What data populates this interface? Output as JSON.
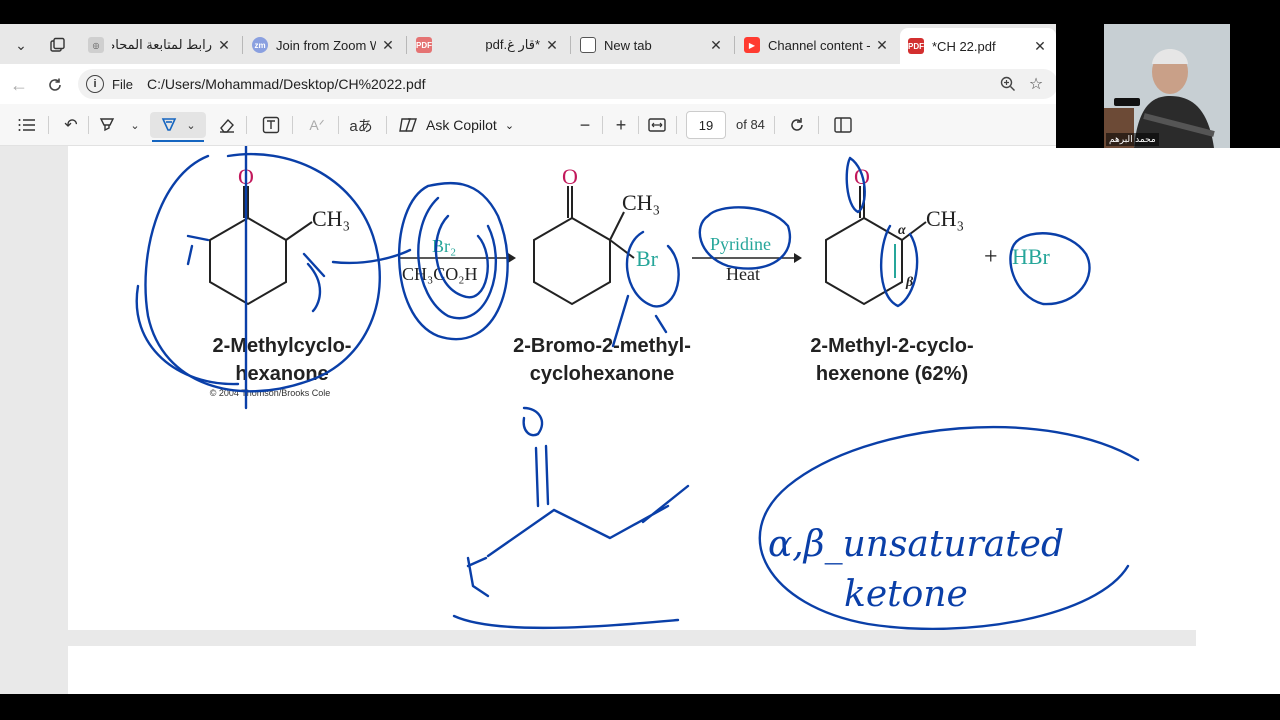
{
  "browser": {
    "tabs": [
      {
        "label": "رابط لمتابعة المحاضرة",
        "icon": "doc-icon",
        "active": false
      },
      {
        "label": "Join from Zoom Wo",
        "icon": "zoom-icon",
        "active": false
      },
      {
        "label": "pdf.قار غ*",
        "icon": "pdf-icon",
        "active": false
      },
      {
        "label": "New tab",
        "icon": "newtab-icon",
        "active": false
      },
      {
        "label": "Channel content - Yo",
        "icon": "youtube-icon",
        "active": false
      },
      {
        "label": "*CH 22.pdf",
        "icon": "pdf-icon",
        "active": true
      }
    ],
    "address": {
      "scheme_label": "File",
      "url": "C:/Users/Mohammad/Desktop/CH%2022.pdf"
    }
  },
  "pdf_toolbar": {
    "ask_copilot": "Ask Copilot",
    "page_current": "19",
    "page_total": "of 84"
  },
  "document": {
    "reaction": {
      "reactant_name_line1": "2-Methylcyclo-",
      "reactant_name_line2": "hexanone",
      "copyright": "© 2004 Thomson/Brooks Cole",
      "reagent1_top": "Br₂",
      "reagent1_bottom": "CH₃CO₂H",
      "intermediate_name_line1": "2-Bromo-2-methyl-",
      "intermediate_name_line2": "cyclohexanone",
      "reagent2_top": "Pyridine",
      "reagent2_bottom": "Heat",
      "product_name_line1": "2-Methyl-2-cyclo-",
      "product_name_line2": "hexenone (62%)",
      "byproduct": "HBr",
      "plus": "+",
      "oxygen": "O",
      "methyl": "CH₃",
      "bromine": "Br",
      "alpha": "α",
      "beta": "β"
    },
    "handwriting": {
      "line1": "α,β_unsaturated",
      "line2": "ketone"
    }
  },
  "video": {
    "participant_name": "محمد البرهم"
  },
  "colors": {
    "ink": "#0a3fa8",
    "oxygen": "#c2185b",
    "highlight": "#26a69a"
  }
}
